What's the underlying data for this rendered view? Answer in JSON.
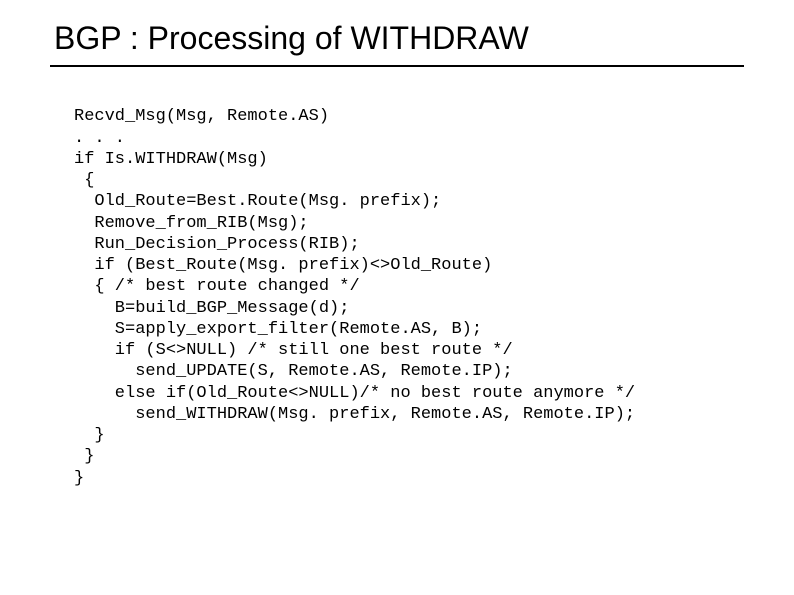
{
  "slide": {
    "title": "BGP : Processing of WITHDRAW",
    "code_lines": {
      "l0": "Recvd_Msg(Msg, Remote.AS)",
      "l1": ". . .",
      "l2": "if Is.WITHDRAW(Msg)",
      "l3": " {",
      "l4": "  Old_Route=Best.Route(Msg. prefix);",
      "l5": "  Remove_from_RIB(Msg);",
      "l6": "  Run_Decision_Process(RIB);",
      "l7": "  if (Best_Route(Msg. prefix)<>Old_Route)",
      "l8": "  { /* best route changed */",
      "l9": "    B=build_BGP_Message(d);",
      "l10": "    S=apply_export_filter(Remote.AS, B);",
      "l11": "    if (S<>NULL) /* still one best route */",
      "l12": "      send_UPDATE(S, Remote.AS, Remote.IP);",
      "l13": "    else if(Old_Route<>NULL)/* no best route anymore */",
      "l14": "      send_WITHDRAW(Msg. prefix, Remote.AS, Remote.IP);",
      "l15": "  }",
      "l16": " }",
      "l17": "}"
    }
  }
}
